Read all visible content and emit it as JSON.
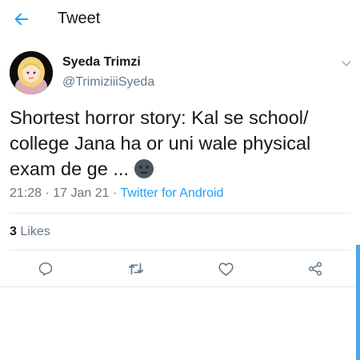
{
  "header": {
    "title": "Tweet",
    "back_icon": "arrow-left-icon",
    "accent_color": "#1da1f2"
  },
  "tweet": {
    "author": {
      "name": "Syeda Trimzi",
      "handle": "@TrimiziiiSyeda",
      "avatar_icon": "hijab-girl-avatar"
    },
    "text": "Shortest horror story: Kal se school/ college Jana ha or uni wale physical exam de ge ...",
    "emoji": "neutral-face-icon",
    "time": "21:28",
    "separator": "·",
    "date": "17 Jan 21",
    "source": "Twitter for Android",
    "likes_count": "3",
    "likes_label": "Likes"
  },
  "actions": [
    {
      "icon": "reply-icon"
    },
    {
      "icon": "retweet-icon"
    },
    {
      "icon": "like-icon"
    },
    {
      "icon": "share-icon"
    }
  ],
  "colors": {
    "text": "#14171a",
    "secondary": "#657786",
    "link": "#1da1f2",
    "divider": "#e1e8ed",
    "scrollbar": "#4aa8e8"
  }
}
